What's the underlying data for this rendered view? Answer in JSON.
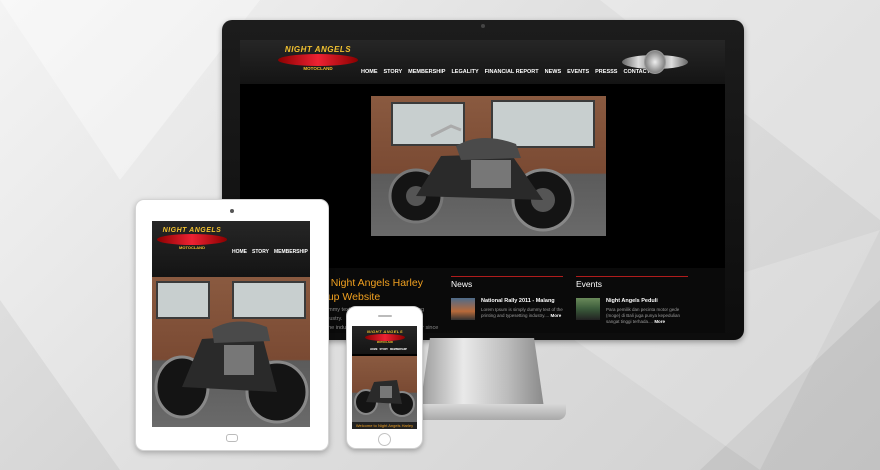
{
  "site": {
    "logo_title": "NIGHT ANGELS",
    "logo_sub": "MOTOCLAND",
    "nav": [
      "HOME",
      "STORY",
      "MEMBERSHIP",
      "LEGALITY",
      "FINANCIAL REPORT",
      "NEWS",
      "EVENTS",
      "PRESSS",
      "CONTACT"
    ],
    "tablet_nav": [
      "HOME",
      "STORY",
      "MEMBERSHIP"
    ],
    "welcome_title": "o Night Angels Harley\noup Website",
    "welcome_text": "dummy text of the printing and typesetting industry.\nn the industry's standard dummy text ever since the\n\nter took a                                       d it to make a",
    "phone_welcome": "Welcome to Night Angels Harley",
    "news": {
      "heading": "News",
      "item_title": "National Rally 2011 - Malang",
      "item_desc": "Lorem Ipsum is simply dummy text of the printing and typesetting industry....",
      "more": "More"
    },
    "events": {
      "heading": "Events",
      "item_title": "Night Angels Peduli",
      "item_desc": "Para pemilik dan pecinta motor gede (moge) di Bali juga punya kepedulian sangat tinggi terhada....",
      "more": "More"
    }
  },
  "colors": {
    "accent_orange": "#f0a020",
    "logo_yellow": "#f2c230",
    "logo_red": "#e22233",
    "divider_red": "#b01c1c",
    "screen_bg": "#000000"
  }
}
